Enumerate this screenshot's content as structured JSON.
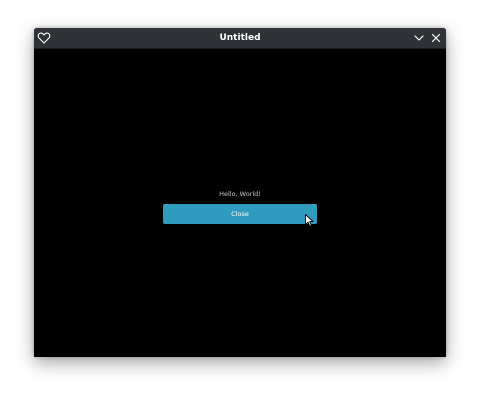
{
  "window": {
    "title": "Untitled",
    "icons": {
      "left": "heart-icon",
      "minimize": "chevron-down-icon",
      "close": "close-icon"
    }
  },
  "content": {
    "greeting": "Hello, World!",
    "close_button_label": "Close"
  },
  "colors": {
    "titlebar": "#2f3236",
    "background": "#000000",
    "button": "#2f9bbf",
    "title_text": "#ffffff",
    "greeting_text": "#c8c8c8"
  }
}
